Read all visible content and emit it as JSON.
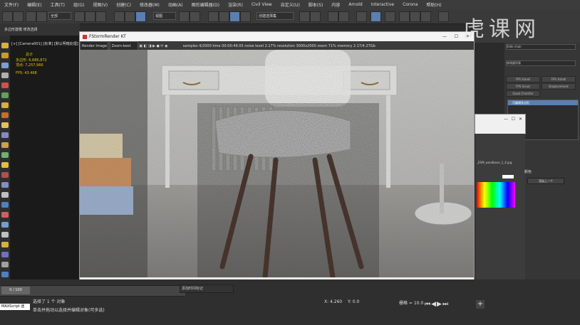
{
  "menu": [
    "文件(F)",
    "编辑(E)",
    "工具(T)",
    "组(G)",
    "视图(V)",
    "创建(C)",
    "修改器(M)",
    "动画(A)",
    "图形编辑器(D)",
    "渲染(R)",
    "Civil View",
    "自定义(U)",
    "脚本(S)",
    "内容",
    "Arnold",
    "Interactive",
    "Corona",
    "帮助(H)"
  ],
  "toolbar": {
    "filter_value": "全部",
    "view_value": "视图",
    "selection_value": "创建选择集"
  },
  "left_viewport": {
    "label_top": "[+] [Camera001] [标准] [默认明暗处理]",
    "label_mode": "多边形建模  修改选择",
    "stat_header": "总计",
    "stat_polys": "多边形: 6,686,872",
    "stat_verts": "顶点: 7,257,966",
    "stat_fps": "FPS: 43.468"
  },
  "render_window": {
    "title": "FStormRender KT",
    "render_dropdown": "Render Image",
    "zoom_dropdown": "Zoom-best",
    "stats": "samples 4/2000  time 00:00:49.05  noise level 2.17%  resolution 3000x2000  zoom 71%  memory 2.17/4.27Gb"
  },
  "right_panel": {
    "dropdown": "Slide chair",
    "modifier_list": "修改器列表",
    "buttons": [
      "FPS Xshell",
      "FPS Xshell",
      "FPS Scout",
      "Displacement",
      "Quad Chamfer"
    ],
    "stack_item": "可编辑多边形"
  },
  "dialog": {
    "file_label": "_ESM_woodbase_1_4.jpg",
    "color_label": "颜色",
    "button_label": "渲染上一个"
  },
  "timeline": {
    "frames": "0 / 100"
  },
  "status": {
    "maxscript": "MAXScript 迷",
    "selected": "选择了 1 个 对象",
    "hint": "单击并拖动以选择并编辑对象(可多选)",
    "grid": "栅格 = 10.0",
    "addtime": "添加时间标记",
    "coord_x": "X: 4.260",
    "coord_y": "Y: 0.0"
  },
  "watermark": "虎课网"
}
